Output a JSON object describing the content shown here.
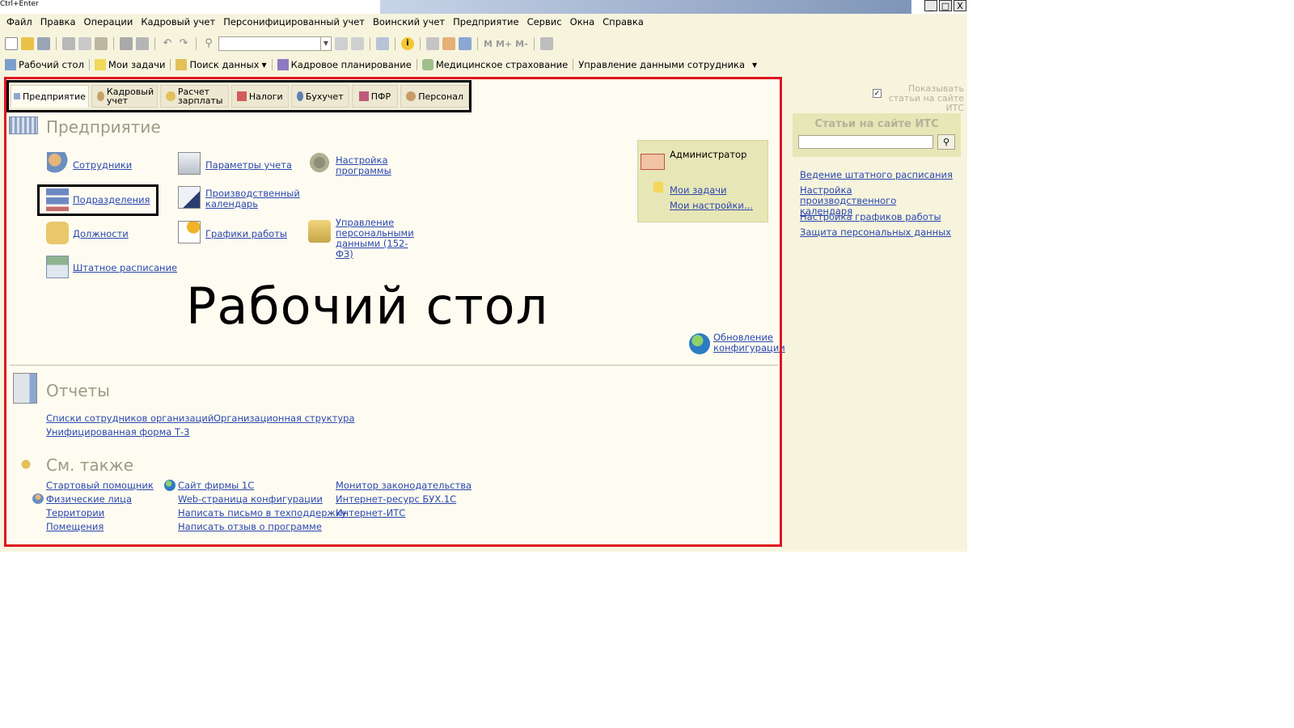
{
  "hotkey_label": "Ctrl+Enter",
  "window_buttons": {
    "minimize": "_",
    "maximize": "□",
    "close": "X"
  },
  "menu": [
    "Файл",
    "Правка",
    "Операции",
    "Кадровый учет",
    "Персонифицированный учет",
    "Воинский учет",
    "Предприятие",
    "Сервис",
    "Окна",
    "Справка"
  ],
  "toolbar": {
    "letters": [
      "M",
      "M+",
      "M-"
    ]
  },
  "quickbar": [
    "Рабочий стол",
    "Мои задачи",
    "Поиск данных",
    "Кадровое планирование",
    "Медицинское страхование",
    "Управление данными сотрудника"
  ],
  "tabs": [
    "Предприятие",
    "Кадровый учет",
    "Расчет зарплаты",
    "Налоги",
    "Бухучет",
    "ПФР",
    "Персонал"
  ],
  "enterprise": {
    "title": "Предприятие",
    "col1": [
      "Сотрудники",
      "Подразделения",
      "Должности",
      "Штатное расписание"
    ],
    "col2": [
      "Параметры учета",
      "Производственный календарь",
      "Графики работы"
    ],
    "col3": [
      "Настройка программы",
      "Управление персональными данными (152-ФЗ)"
    ],
    "update": "Обновление конфигурации"
  },
  "admin": {
    "name": "Администратор",
    "tasks": "Мои задачи",
    "settings": "Мои настройки..."
  },
  "overlay_text": "Рабочий стол",
  "reports": {
    "title": "Отчеты",
    "links": [
      "Списки сотрудников организаций",
      "Унифицированная форма Т-3",
      "Организационная структура"
    ]
  },
  "seealso": {
    "title": "См. также",
    "col1": [
      "Стартовый помощник",
      "Физические лица",
      "Территории",
      "Помещения"
    ],
    "col2": [
      "Сайт фирмы 1С",
      "Web-страница конфигурации",
      "Написать письмо в техподдержку",
      "Написать отзыв о программе"
    ],
    "col3": [
      "Монитор законодательства",
      "Интернет-ресурс БУХ.1С",
      "Интернет-ИТС"
    ]
  },
  "right_panel": {
    "show_articles": "Показывать статьи на сайте ИТС",
    "show_articles_checked": true,
    "its_title": "Статьи на сайте ИТС",
    "search_value": "",
    "links": [
      "Ведение штатного расписания",
      "Настройка производственного календаря",
      "Настройка графиков работы",
      "Защита персональных данных"
    ]
  },
  "colors": {
    "frame_red": "#e0141e",
    "link_blue": "#2b47b0",
    "panel_bg": "#fefcf1",
    "app_bg": "#f7f4de"
  }
}
